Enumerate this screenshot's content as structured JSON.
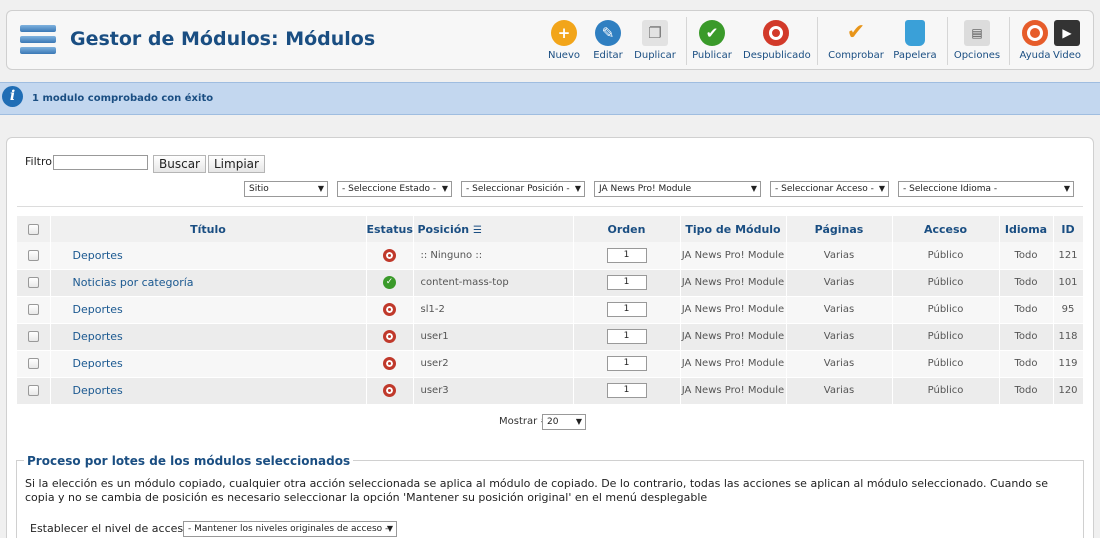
{
  "header": {
    "title": "Gestor de Módulos: Módulos",
    "toolbar": [
      {
        "label": "Nuevo",
        "icon": "plus-icon",
        "color": "#f2a51a",
        "glyph": "+"
      },
      {
        "label": "Editar",
        "icon": "pencil-icon",
        "color": "#2f7fc1",
        "glyph": "✎"
      },
      {
        "label": "Duplicar",
        "icon": "copy-icon",
        "color": "#d8d8d8",
        "glyph": "❐"
      },
      {
        "label": "Publicar",
        "icon": "check-icon",
        "color": "#3a9a2a",
        "glyph": "✔"
      },
      {
        "label": "Despublicado",
        "icon": "unpublish-icon",
        "color": "#d23a2a",
        "glyph": "●"
      },
      {
        "label": "Comprobar",
        "icon": "checkmark-icon",
        "color": "#f2f2f2",
        "glyph": "✔"
      },
      {
        "label": "Papelera",
        "icon": "trash-icon",
        "color": "#3aa0d8",
        "glyph": "🗑"
      },
      {
        "label": "Opciones",
        "icon": "options-icon",
        "color": "#cfcfcf",
        "glyph": "⚙"
      },
      {
        "label": "Ayuda",
        "icon": "lifebuoy-icon",
        "color": "#e65c2a",
        "glyph": "✚"
      },
      {
        "label": "Video",
        "icon": "film-icon",
        "color": "#333333",
        "glyph": "▶"
      }
    ]
  },
  "message": {
    "text": "1 modulo comprobado con éxito"
  },
  "filter": {
    "label": "Filtro:",
    "value": "",
    "search_button": "Buscar",
    "clear_button": "Limpiar",
    "selects": [
      {
        "value": "Sitio"
      },
      {
        "value": "- Seleccione Estado -"
      },
      {
        "value": "- Seleccionar Posición -"
      },
      {
        "value": "JA News Pro! Module"
      },
      {
        "value": "- Seleccionar Acceso -"
      },
      {
        "value": "- Seleccione Idioma -"
      }
    ]
  },
  "table": {
    "headers": {
      "title": "Título",
      "status": "Estatus",
      "position": "Posición",
      "order": "Orden",
      "type": "Tipo de Módulo",
      "pages": "Páginas",
      "access": "Acceso",
      "language": "Idioma",
      "id": "ID"
    },
    "rows": [
      {
        "title": "Deportes",
        "status": "unpublished",
        "position": ":: Ninguno ::",
        "order": "1",
        "type": "JA News Pro! Module",
        "pages": "Varias",
        "access": "Público",
        "language": "Todo",
        "id": "121"
      },
      {
        "title": "Noticias por categoría",
        "status": "published",
        "position": "content-mass-top",
        "order": "1",
        "type": "JA News Pro! Module",
        "pages": "Varias",
        "access": "Público",
        "language": "Todo",
        "id": "101"
      },
      {
        "title": "Deportes",
        "status": "unpublished",
        "position": "sl1-2",
        "order": "1",
        "type": "JA News Pro! Module",
        "pages": "Varias",
        "access": "Público",
        "language": "Todo",
        "id": "95"
      },
      {
        "title": "Deportes",
        "status": "unpublished",
        "position": "user1",
        "order": "1",
        "type": "JA News Pro! Module",
        "pages": "Varias",
        "access": "Público",
        "language": "Todo",
        "id": "118"
      },
      {
        "title": "Deportes",
        "status": "unpublished",
        "position": "user2",
        "order": "1",
        "type": "JA News Pro! Module",
        "pages": "Varias",
        "access": "Público",
        "language": "Todo",
        "id": "119"
      },
      {
        "title": "Deportes",
        "status": "unpublished",
        "position": "user3",
        "order": "1",
        "type": "JA News Pro! Module",
        "pages": "Varias",
        "access": "Público",
        "language": "Todo",
        "id": "120"
      }
    ]
  },
  "pagination": {
    "label": "Mostrar #",
    "value": "20"
  },
  "batch": {
    "legend": "Proceso por lotes de los módulos seleccionados",
    "description": "Si la elección es un módulo copiado, cualquier otra acción seleccionada se aplica al módulo de copiado. De lo contrario, todas las acciones se aplican al módulo seleccionado. Cuando se copia y no se cambia de posición es necesario seleccionar la opción 'Mantener su posición original' en el menú desplegable",
    "access_label": "Establecer el nivel de acceso",
    "access_value": "- Mantener los niveles originales de acceso -"
  },
  "colors": {
    "title_blue": "#1a4e82",
    "message_bg": "#c3d7ef",
    "published": "#3a9a2a",
    "unpublished": "#c0392b"
  }
}
